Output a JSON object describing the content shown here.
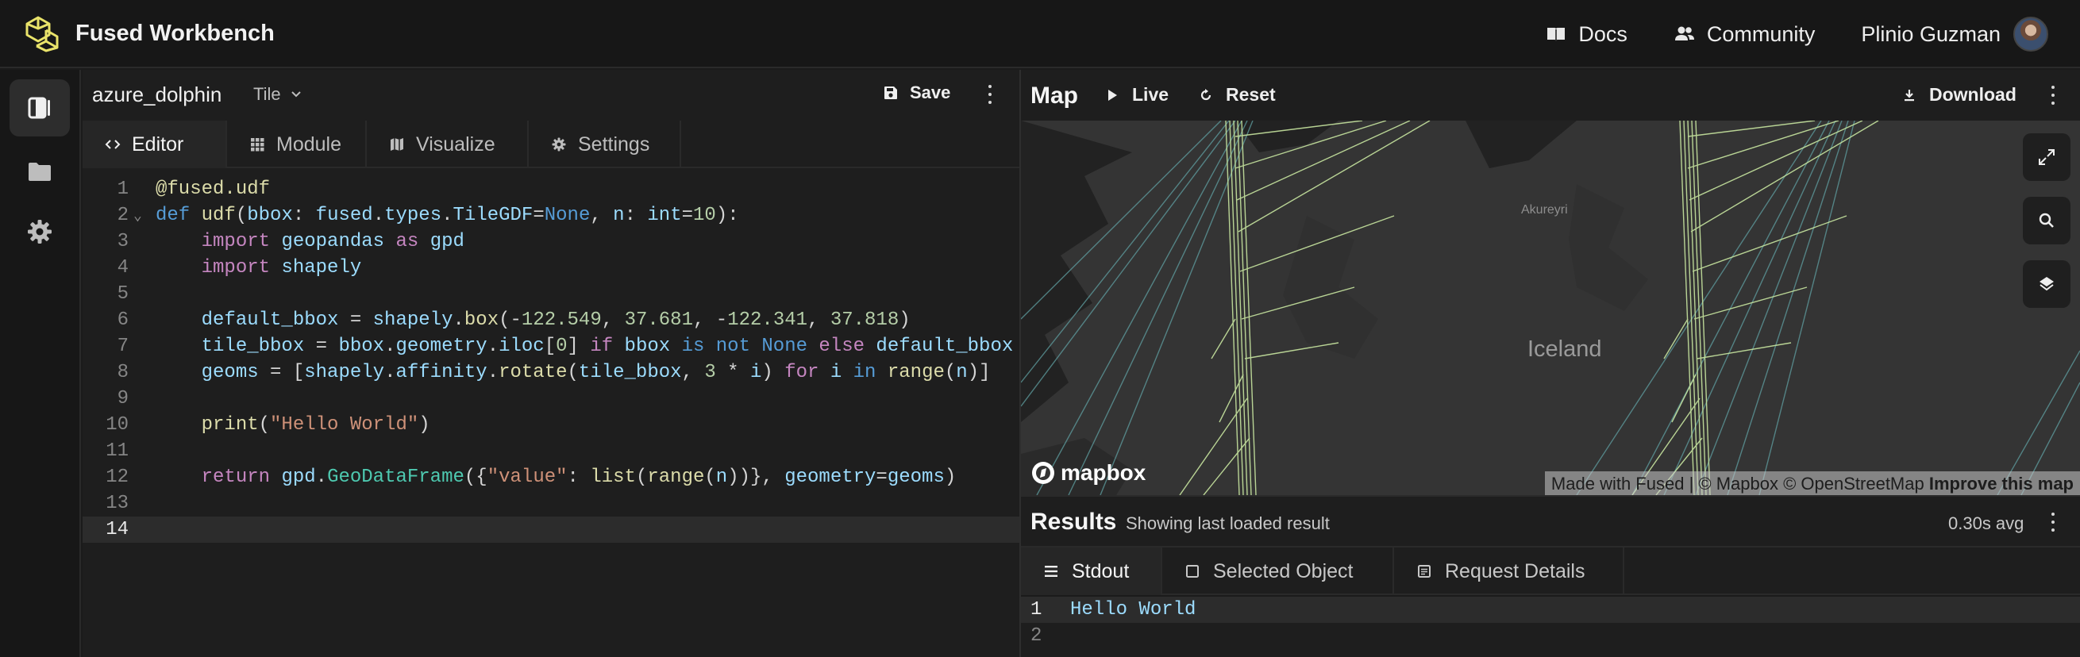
{
  "app": {
    "title": "Fused Workbench",
    "nav": {
      "docs": "Docs",
      "community": "Community"
    },
    "user": {
      "name": "Plinio Guzman"
    }
  },
  "sidebar": {
    "items": [
      {
        "icon": "udf-panel-icon",
        "active": true
      },
      {
        "icon": "folder-icon",
        "active": false
      },
      {
        "icon": "gear-icon",
        "active": false
      }
    ]
  },
  "editor": {
    "file_name": "azure_dolphin",
    "file_type": "Tile",
    "save_label": "Save",
    "tabs": [
      {
        "label": "Editor",
        "icon": "code-icon",
        "active": true
      },
      {
        "label": "Module",
        "icon": "grid-icon",
        "active": false
      },
      {
        "label": "Visualize",
        "icon": "map-icon",
        "active": false
      },
      {
        "label": "Settings",
        "icon": "gear-icon",
        "active": false
      }
    ],
    "current_line": 14,
    "code_lines": [
      "@fused.udf",
      "def udf(bbox: fused.types.TileGDF=None, n: int=10):",
      "    import geopandas as gpd",
      "    import shapely",
      "",
      "    default_bbox = shapely.box(-122.549, 37.681, -122.341, 37.818)",
      "    tile_bbox = bbox.geometry.iloc[0] if bbox is not None else default_bbox",
      "    geoms = [shapely.affinity.rotate(tile_bbox, 3 * i) for i in range(n)]",
      "",
      "    print(\"Hello World\")",
      "",
      "    return gpd.GeoDataFrame({\"value\": list(range(n))}, geometry=geoms)",
      "",
      ""
    ]
  },
  "map": {
    "title": "Map",
    "live_label": "Live",
    "reset_label": "Reset",
    "download_label": "Download",
    "labels": {
      "country": "Iceland",
      "city": "Akureyri"
    },
    "logo_text": "mapbox",
    "attribution": {
      "fused": "Made with Fused",
      "sep": " | © Mapbox © OpenStreetMap ",
      "improve": "Improve this map"
    },
    "colors": {
      "land": "#343434",
      "water": "#222222",
      "lines_light": "#c8e6a0",
      "lines_teal": "#5f9ea0"
    }
  },
  "results": {
    "title": "Results",
    "subtitle": "Showing last loaded result",
    "avg": "0.30s avg",
    "tabs": [
      {
        "label": "Stdout",
        "icon": "list-icon",
        "active": true
      },
      {
        "label": "Selected Object",
        "icon": "square-icon",
        "active": false
      },
      {
        "label": "Request Details",
        "icon": "document-icon",
        "active": false
      }
    ],
    "stdout_lines": [
      "Hello World",
      ""
    ]
  }
}
